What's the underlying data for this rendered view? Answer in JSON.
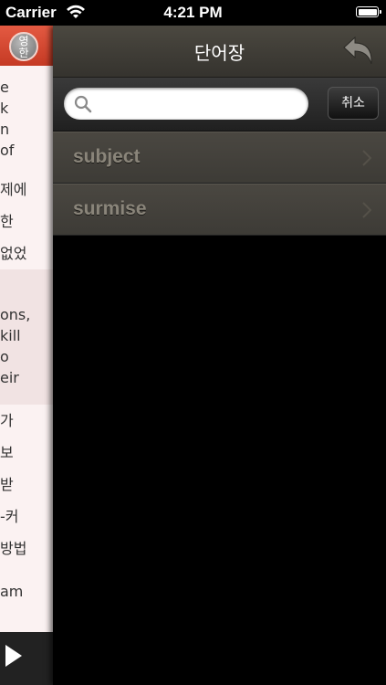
{
  "status_bar": {
    "carrier": "Carrier",
    "time": "4:21 PM"
  },
  "left_panel": {
    "lang_toggle_top": "영",
    "lang_toggle_bottom": "한",
    "lines": [
      "e",
      "k",
      "n",
      "of",
      "",
      "제에",
      "한",
      "없었",
      "",
      "ons,",
      "kill",
      "o",
      "eir",
      "",
      "가",
      "보",
      "받",
      "-커",
      "방법",
      "",
      "am"
    ]
  },
  "vocab": {
    "title": "단어장",
    "search_placeholder": "",
    "cancel_label": "취소",
    "words": [
      "subject",
      "surmise"
    ]
  },
  "colors": {
    "header_bg": "#3f3c36",
    "left_header_red": "#d64a32",
    "word_text": "#8a857a"
  }
}
